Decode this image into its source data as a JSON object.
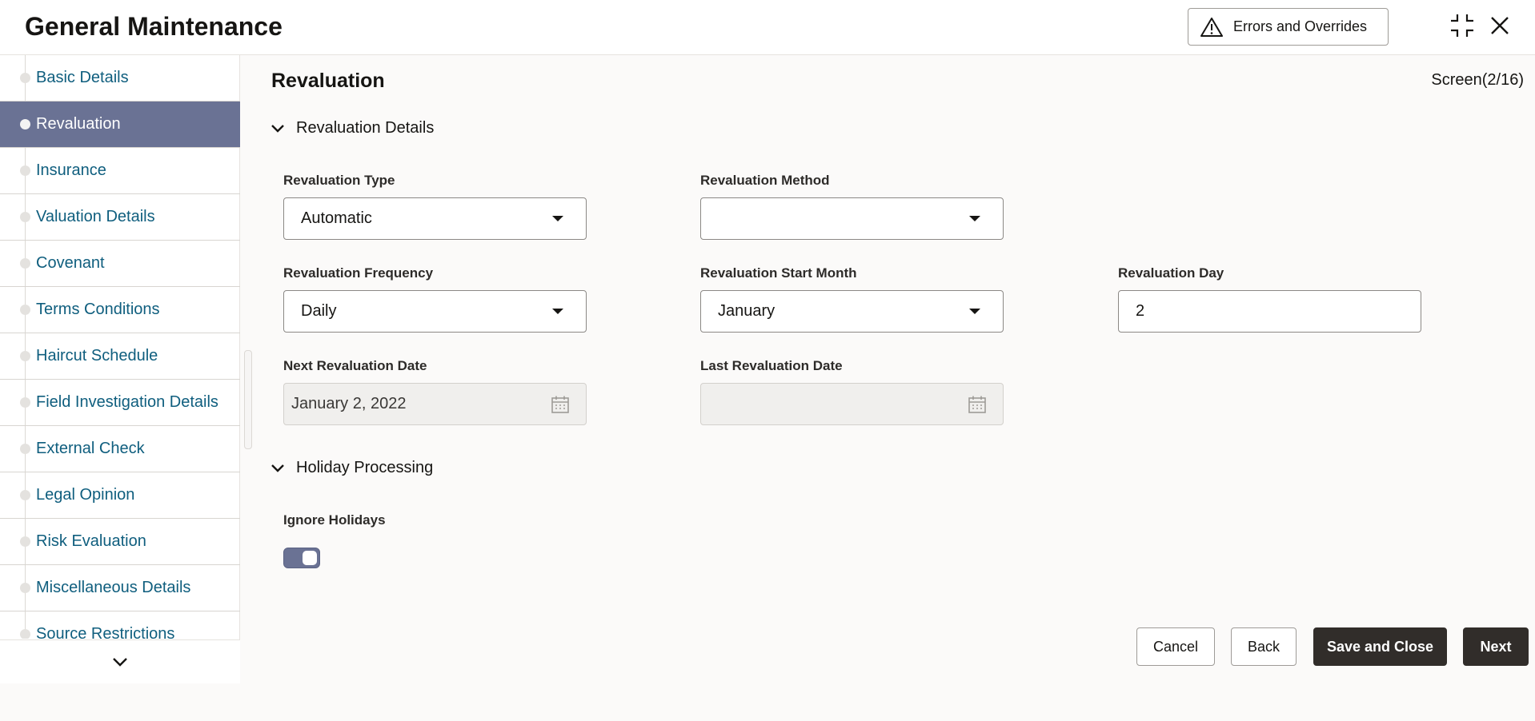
{
  "header": {
    "title": "General Maintenance",
    "errors_label": "Errors and Overrides"
  },
  "sidebar": {
    "items": [
      {
        "label": "Basic Details"
      },
      {
        "label": "Revaluation",
        "active": true
      },
      {
        "label": "Insurance"
      },
      {
        "label": "Valuation Details"
      },
      {
        "label": "Covenant"
      },
      {
        "label": "Terms Conditions"
      },
      {
        "label": "Haircut Schedule"
      },
      {
        "label": "Field Investigation Details"
      },
      {
        "label": "External Check"
      },
      {
        "label": "Legal Opinion"
      },
      {
        "label": "Risk Evaluation"
      },
      {
        "label": "Miscellaneous Details"
      },
      {
        "label": "Source Restrictions"
      }
    ]
  },
  "main": {
    "title": "Revaluation",
    "screen_indicator": "Screen(2/16)",
    "revaluation_details": {
      "heading": "Revaluation Details",
      "type_label": "Revaluation Type",
      "type_value": "Automatic",
      "method_label": "Revaluation Method",
      "method_value": "",
      "frequency_label": "Revaluation Frequency",
      "frequency_value": "Daily",
      "start_month_label": "Revaluation Start Month",
      "start_month_value": "January",
      "day_label": "Revaluation Day",
      "day_value": "2",
      "next_date_label": "Next Revaluation Date",
      "next_date_value": "January 2, 2022",
      "last_date_label": "Last Revaluation Date",
      "last_date_value": ""
    },
    "holiday_processing": {
      "heading": "Holiday Processing",
      "ignore_label": "Ignore Holidays",
      "ignore_on": true
    }
  },
  "footer": {
    "cancel": "Cancel",
    "back": "Back",
    "save_close": "Save and Close",
    "next": "Next"
  },
  "colors": {
    "active_nav": "#6a7294",
    "link": "#0f5e7e",
    "primary_button": "#312d2a"
  }
}
